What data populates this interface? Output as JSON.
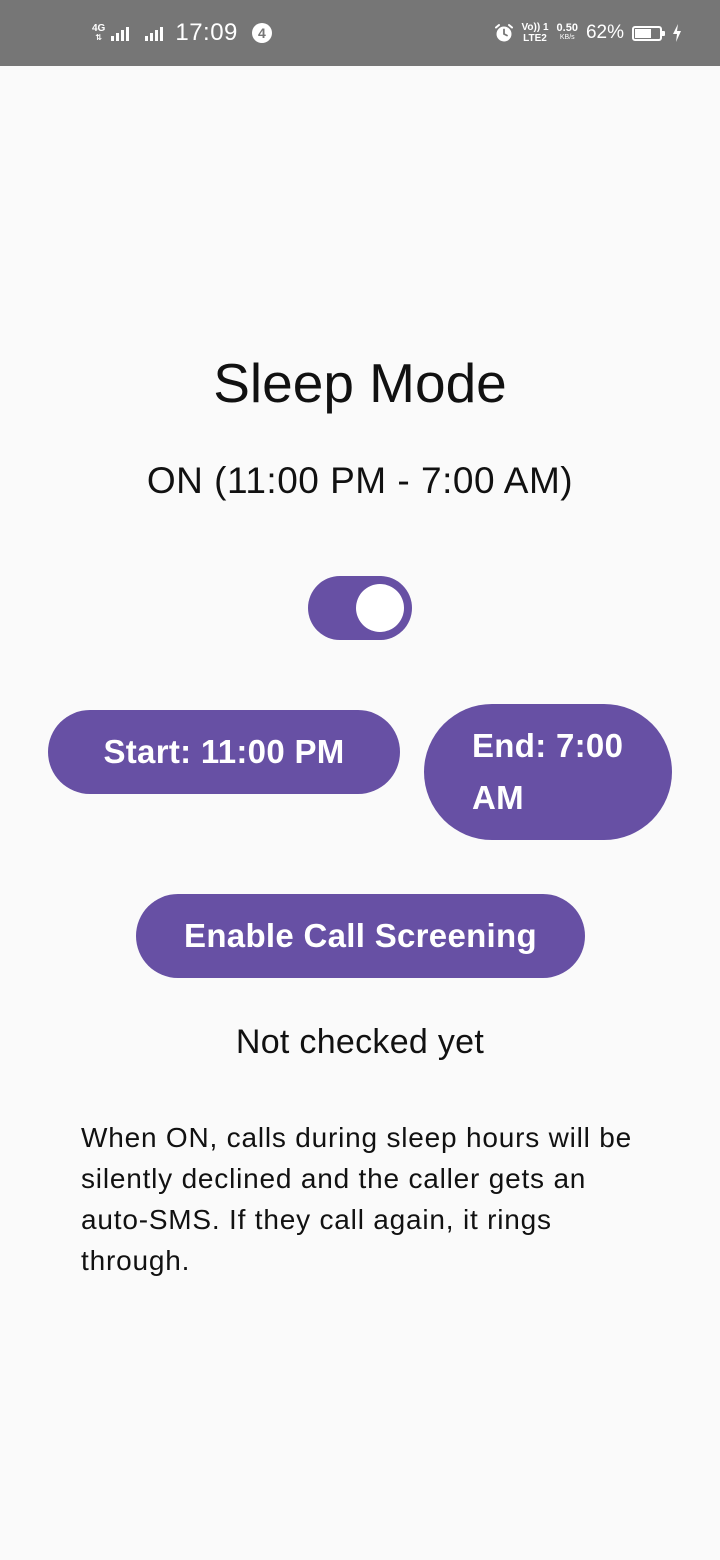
{
  "status_bar": {
    "network_type": "4G",
    "time": "17:09",
    "notification_count": "4",
    "volte_line1": "Vo)) 1",
    "volte_line2": "LTE2",
    "speed_value": "0.50",
    "speed_unit": "KB/s",
    "battery_percent": "62%",
    "battery_level": 0.62,
    "icons": [
      "signal-icon",
      "alarm-icon",
      "battery-icon",
      "charging-icon"
    ]
  },
  "main": {
    "title": "Sleep Mode",
    "status": "ON (11:00 PM - 7:00 AM)",
    "toggle_on": true,
    "start_button": "Start: 11:00 PM",
    "end_button": "End: 7:00 AM",
    "screening_button": "Enable Call Screening",
    "check_status": "Not checked yet",
    "description": "When ON, calls during sleep hours will be silently declined and the caller gets an auto-SMS. If they call again, it rings through."
  },
  "colors": {
    "accent": "#6750a4",
    "status_bar": "#767676",
    "background": "#fafafa"
  }
}
